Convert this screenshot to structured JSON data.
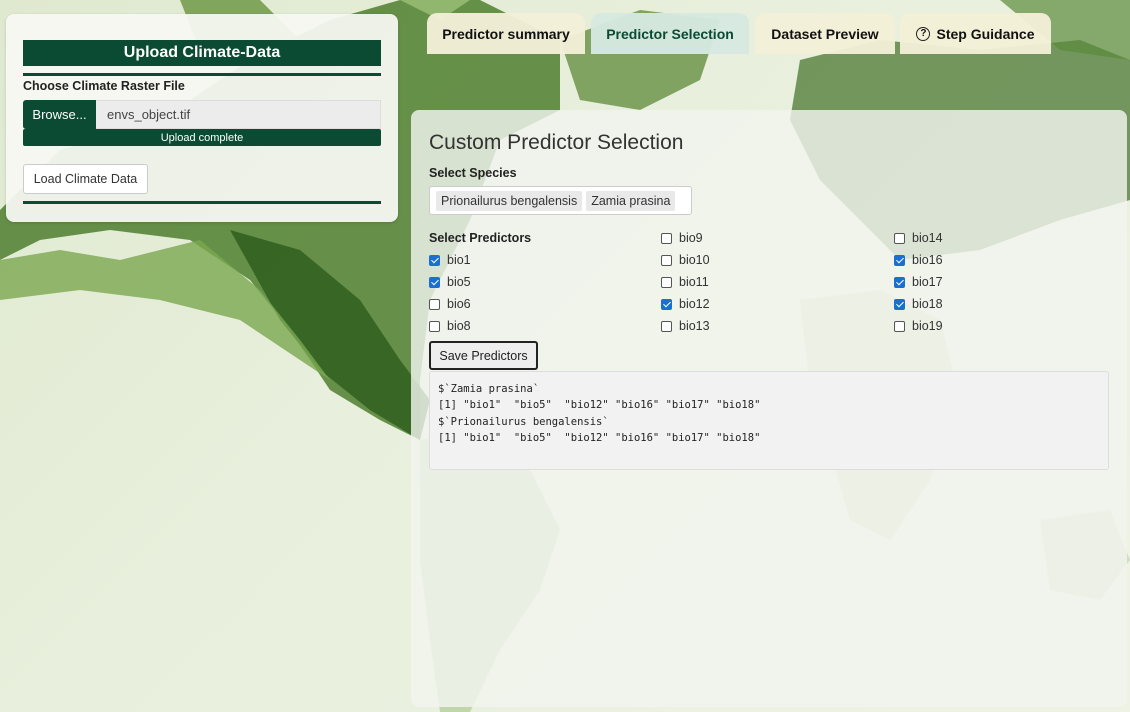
{
  "colors": {
    "brand_green": "#0b4a33",
    "active_tab_bg": "#d6e8e0",
    "tab_bg": "#f3efd7",
    "checkbox_checked": "#1a6fd1"
  },
  "upload": {
    "header": "Upload Climate-Data",
    "choose_label": "Choose Climate Raster File",
    "browse_label": "Browse...",
    "file_name": "envs_object.tif",
    "progress_text": "Upload complete",
    "progress_value": 1.0,
    "load_button": "Load Climate Data"
  },
  "tabs": [
    {
      "label": "Predictor summary",
      "active": false
    },
    {
      "label": "Predictor Selection",
      "active": true
    },
    {
      "label": "Dataset Preview",
      "active": false
    },
    {
      "label": "Step Guidance",
      "active": false,
      "icon": "question-circle-icon"
    }
  ],
  "main": {
    "title": "Custom Predictor Selection",
    "species_label": "Select Species",
    "species": [
      "Prionailurus bengalensis",
      "Zamia prasina"
    ],
    "predictors_label": "Select Predictors",
    "predictors": [
      {
        "name": "bio1",
        "checked": true
      },
      {
        "name": "bio5",
        "checked": true
      },
      {
        "name": "bio6",
        "checked": false
      },
      {
        "name": "bio8",
        "checked": false
      },
      {
        "name": "bio9",
        "checked": false
      },
      {
        "name": "bio10",
        "checked": false
      },
      {
        "name": "bio11",
        "checked": false
      },
      {
        "name": "bio12",
        "checked": true
      },
      {
        "name": "bio13",
        "checked": false
      },
      {
        "name": "bio14",
        "checked": false
      },
      {
        "name": "bio16",
        "checked": true
      },
      {
        "name": "bio17",
        "checked": true
      },
      {
        "name": "bio18",
        "checked": true
      },
      {
        "name": "bio19",
        "checked": false
      }
    ],
    "save_button": "Save Predictors",
    "output_lines": [
      "$`Zamia prasina`",
      "[1] \"bio1\"  \"bio5\"  \"bio12\" \"bio16\" \"bio17\" \"bio18\"",
      "",
      "$`Prionailurus bengalensis`",
      "[1] \"bio1\"  \"bio5\"  \"bio12\" \"bio16\" \"bio17\" \"bio18\""
    ]
  }
}
